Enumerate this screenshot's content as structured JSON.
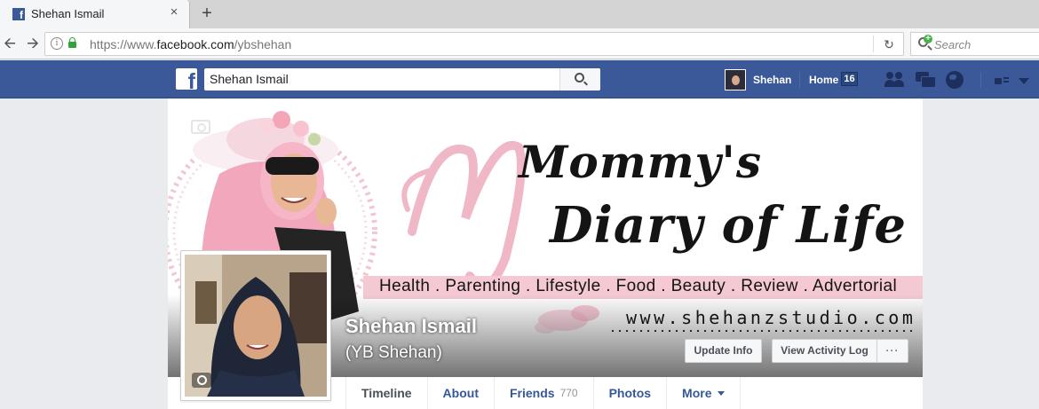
{
  "browser": {
    "tab_title": "Shehan Ismail",
    "new_tab": "+",
    "close": "×",
    "url_prefix": "https://www.",
    "url_domain": "facebook.com",
    "url_path": "/ybshehan",
    "search_placeholder": "Search"
  },
  "fb_header": {
    "logo": "f",
    "search_value": "Shehan Ismail",
    "user_name": "Shehan",
    "home_label": "Home",
    "home_count": "16"
  },
  "cover": {
    "title_line1": "Mommy's",
    "title_line2": "Diary of Life",
    "tagline": "Health . Parenting . Lifestyle . Food . Beauty . Review . Advertorial",
    "website": "www.shehanzstudio.com",
    "profile_name": "Shehan Ismail",
    "nickname": "(YB Shehan)",
    "update_info": "Update Info",
    "view_activity_log": "View Activity Log",
    "more": "···"
  },
  "profile_tabs": [
    {
      "label": "Timeline"
    },
    {
      "label": "About"
    },
    {
      "label": "Friends",
      "count": "770"
    },
    {
      "label": "Photos"
    },
    {
      "label": "More"
    }
  ],
  "colors": {
    "fb_blue": "#3b5998",
    "link_blue": "#365899",
    "cover_pink": "#f4c9d3"
  }
}
